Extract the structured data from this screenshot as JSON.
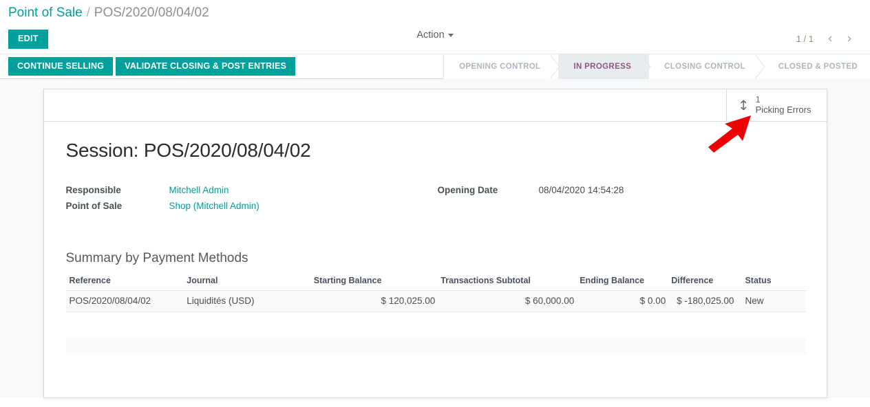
{
  "breadcrumb": {
    "root": "Point of Sale",
    "separator": "/",
    "current": "POS/2020/08/04/02"
  },
  "control_panel": {
    "edit_label": "EDIT",
    "action_label": "Action",
    "pager": {
      "count": "1 / 1",
      "prev_icon": "‹",
      "next_icon": "›"
    },
    "buttons": [
      {
        "label": "CONTINUE SELLING"
      },
      {
        "label": "VALIDATE CLOSING & POST ENTRIES"
      }
    ],
    "statusbar": [
      {
        "label": "OPENING CONTROL",
        "active": false
      },
      {
        "label": "IN PROGRESS",
        "active": true
      },
      {
        "label": "CLOSING CONTROL",
        "active": false
      },
      {
        "label": "CLOSED & POSTED",
        "active": false
      }
    ]
  },
  "stat_button": {
    "icon": "↕",
    "value": "1",
    "label": "Picking Errors"
  },
  "form": {
    "title": "Session: POS/2020/08/04/02",
    "fields": {
      "responsible_label": "Responsible",
      "responsible_value": "Mitchell Admin",
      "opening_date_label": "Opening Date",
      "opening_date_value": "08/04/2020 14:54:28",
      "pos_label": "Point of Sale",
      "pos_value": "Shop (Mitchell Admin)"
    },
    "summary": {
      "title": "Summary by Payment Methods",
      "columns": [
        "Reference",
        "Journal",
        "Starting Balance",
        "Transactions Subtotal",
        "Ending Balance",
        "Difference",
        "Status"
      ],
      "rows": [
        {
          "reference": "POS/2020/08/04/02",
          "journal": "Liquidités (USD)",
          "starting_balance": "$ 120,025.00",
          "transactions_subtotal": "$ 60,000.00",
          "ending_balance": "$ 0.00",
          "difference": "$ -180,025.00",
          "status": "New"
        }
      ]
    }
  },
  "colors": {
    "brand_teal": "#00A09D",
    "odoo_purple": "#875A7B",
    "annotation_red": "#EE0000"
  }
}
